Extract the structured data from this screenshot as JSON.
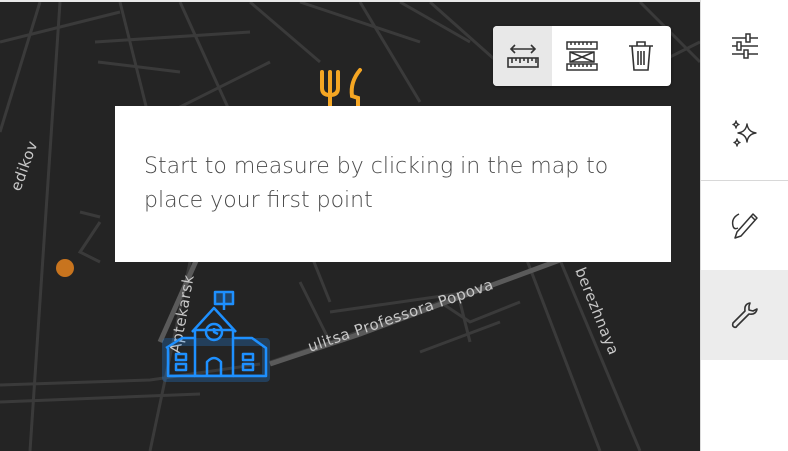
{
  "map": {
    "road_labels": {
      "aptekarsky": "Aptekarsk",
      "professora_popova": "ulitsa Professora Popova",
      "naberezhnaya": "berezhnaya",
      "left_edge": "edikov"
    },
    "markers": {
      "restaurant": "restaurant-icon",
      "school": "school-icon",
      "poi_dot": "poi-dot"
    },
    "colors": {
      "background": "#242424",
      "roads": "#3a3a3a",
      "restaurant": "#f5a623",
      "school": "#1e90ff",
      "poi": "#c8741e"
    }
  },
  "measure_toolbar": {
    "tools": [
      {
        "icon": "measure-distance-icon",
        "active": true
      },
      {
        "icon": "measure-area-icon",
        "active": false
      },
      {
        "icon": "trash-icon",
        "active": false
      }
    ]
  },
  "tooltip": {
    "text": "Start to measure by clicking in the map to place your first point"
  },
  "side_rail": {
    "buttons": [
      {
        "icon": "sliders-icon",
        "active": false
      },
      {
        "icon": "sparkles-icon",
        "active": false
      },
      {
        "icon": "sketch-pencil-icon",
        "active": false
      },
      {
        "icon": "wrench-icon",
        "active": true
      }
    ]
  }
}
